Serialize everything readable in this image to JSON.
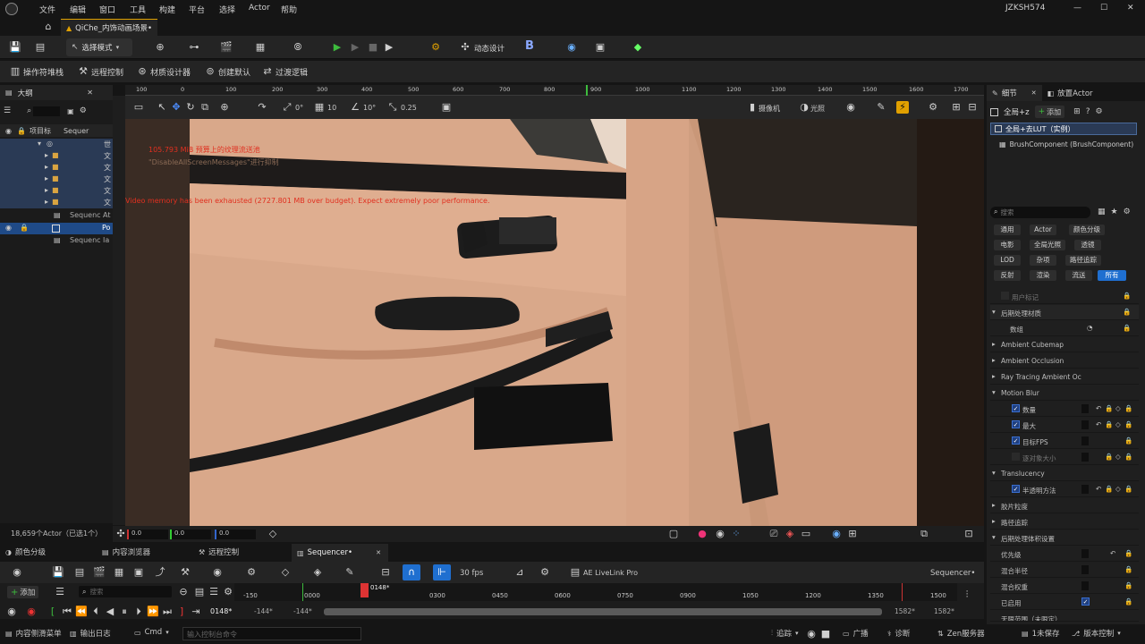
{
  "menubar": {
    "items": [
      "文件",
      "编辑",
      "窗口",
      "工具",
      "构建",
      "平台",
      "选择",
      "Actor",
      "帮助"
    ],
    "user": "JZKSH574"
  },
  "tab": {
    "title": "QiChe_内饰动画场景•"
  },
  "toolbar1": {
    "mode": "选择模式",
    "dynamic_design": "动态设计"
  },
  "toolbar2": {
    "items": [
      "操作符堆栈",
      "远程控制",
      "材质设计器",
      "创建默认",
      "过渡逻辑"
    ]
  },
  "outliner": {
    "title": "大纲",
    "col_label": "项目标",
    "col_type": "Sequer",
    "rows": [
      {
        "label": "世",
        "indent": 0
      },
      {
        "label": "文",
        "indent": 1
      },
      {
        "label": "文",
        "indent": 1
      },
      {
        "label": "文",
        "indent": 1
      },
      {
        "label": "文",
        "indent": 1
      },
      {
        "label": "文",
        "indent": 1
      },
      {
        "label": "Sequenc",
        "tag": "At",
        "indent": 1
      },
      {
        "label": "Po",
        "indent": 1
      },
      {
        "label": "Sequenc",
        "tag": "Ia",
        "indent": 1
      }
    ],
    "count": "18,659个Actor（已选1个）"
  },
  "ruler": {
    "ticks": [
      "100",
      "0",
      "100",
      "200",
      "300",
      "400",
      "500",
      "600",
      "700",
      "800",
      "900",
      "1000",
      "1100",
      "1200",
      "1300",
      "1400",
      "1500",
      "1600",
      "1700"
    ]
  },
  "viewport_toolbar": {
    "snap1": "0°",
    "snap2": "10",
    "snap3": "10°",
    "snap4": "0.25",
    "camera": "摄像机",
    "lighting": "光照"
  },
  "viewport": {
    "msg1": "105.793 MiB 预算上的纹理流送池",
    "msg2": "\"DisableAllScreenMessages\"进行抑制",
    "msg3": "Video memory has been exhausted (2727.801 MB over budget). Expect extremely poor performance."
  },
  "vp_bottom": {
    "f1": "0.0",
    "f2": "0.0",
    "f3": "0.0"
  },
  "details": {
    "tab1": "细节",
    "tab2": "放置Actor",
    "actor_name": "全局+z",
    "add_label": "添加",
    "instance": "全局+去LUT（实例）",
    "component": "BrushComponent (BrushComponent)",
    "search_placeholder": "搜索",
    "filters": [
      "通用",
      "Actor",
      "颜色分级",
      "电影",
      "全局光照",
      "透镜",
      "LOD",
      "杂项",
      "路径追踪",
      "反射",
      "渲染",
      "流送",
      "所有"
    ],
    "props": [
      {
        "label": "用户标记",
        "type": "row"
      },
      {
        "label": "后期处理材质",
        "type": "section"
      },
      {
        "label": "数组",
        "type": "row"
      },
      {
        "label": "Ambient Cubemap",
        "type": "collapsed"
      },
      {
        "label": "Ambient Occlusion",
        "type": "collapsed"
      },
      {
        "label": "Ray Tracing Ambient Oc",
        "type": "collapsed"
      },
      {
        "label": "Motion Blur",
        "type": "section"
      },
      {
        "label": "数量",
        "type": "check"
      },
      {
        "label": "最大",
        "type": "check"
      },
      {
        "label": "目标FPS",
        "type": "check"
      },
      {
        "label": "逐对象大小",
        "type": "check_off"
      },
      {
        "label": "Translucency",
        "type": "section"
      },
      {
        "label": "半透明方法",
        "type": "check"
      },
      {
        "label": "胶片粒度",
        "type": "collapsed"
      },
      {
        "label": "路径追踪",
        "type": "collapsed"
      },
      {
        "label": "后期处理体积设置",
        "type": "section"
      },
      {
        "label": "优先级",
        "type": "row"
      },
      {
        "label": "混合半径",
        "type": "row"
      },
      {
        "label": "混合权重",
        "type": "row"
      },
      {
        "label": "已启用",
        "type": "row_check"
      },
      {
        "label": "无限范围（未限定）",
        "type": "row"
      }
    ]
  },
  "bottom_tabs": [
    "颜色分级",
    "内容浏览器",
    "远程控制",
    "Sequencer•"
  ],
  "sequencer": {
    "add_label": "添加",
    "search_placeholder": "搜索",
    "fps": "30 fps",
    "livelink": "AE LiveLink Pro",
    "seq_name": "Sequencer•",
    "current_frame": "0148*",
    "frame_field": "0148*",
    "start": "-144*",
    "start2": "-144*",
    "end": "1582*",
    "end2": "1582*",
    "ticks": [
      "-150",
      "0000",
      "0148*",
      "0300",
      "0450",
      "0600",
      "0750",
      "0900",
      "1050",
      "1200",
      "1350",
      "1500"
    ]
  },
  "statusbar": {
    "content_drawer": "内容侧滑菜单",
    "output_log": "输出日志",
    "cmd": "Cmd",
    "cmd_placeholder": "输入控制台命令",
    "trace": "追踪",
    "broadcast": "广播",
    "diagnose": "诊断",
    "zen": "Zen服务器",
    "unsaved": "1未保存",
    "version": "版本控制"
  }
}
